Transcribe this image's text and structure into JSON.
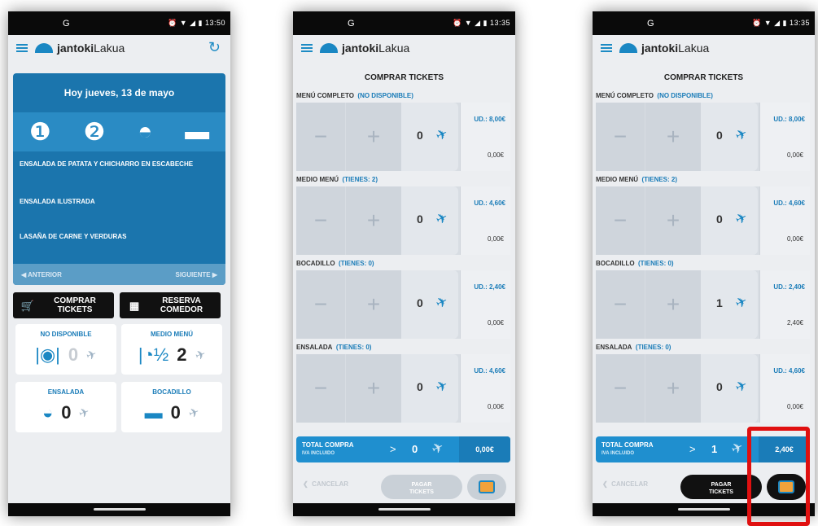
{
  "phone1": {
    "status": {
      "left": "G",
      "right": "⏰ ▼ ◢ ▮ 13:50"
    },
    "brand": {
      "bold": "jantoki",
      "light": "Lakua"
    },
    "date": "Hoy jueves, 13 de mayo",
    "dishes": [
      "ENSALADA DE PATATA Y CHICHARRO EN ESCABECHE",
      "ENSALADA ILUSTRADA",
      "LASAÑA DE CARNE Y VERDURAS"
    ],
    "prev": "◀  ANTERIOR",
    "next": "SIGUIENTE  ▶",
    "buy_btn": "COMPRAR\nTICKETS",
    "reserve_btn": "RESERVA\nCOMEDOR",
    "tiles": [
      {
        "label": "NO DISPONIBLE",
        "count": "0",
        "icon": "meal-icon"
      },
      {
        "label": "MEDIO MENÚ",
        "count": "2",
        "icon": "half-meal-icon"
      },
      {
        "label": "ENSALADA",
        "count": "0",
        "icon": "salad-icon"
      },
      {
        "label": "BOCADILLO",
        "count": "0",
        "icon": "sandwich-icon"
      }
    ]
  },
  "phone2": {
    "status": {
      "left": "G",
      "right": "⏰ ▼ ◢ ▮ 13:35"
    },
    "brand": {
      "bold": "jantoki",
      "light": "Lakua"
    },
    "title": "COMPRAR TICKETS",
    "sections": [
      {
        "name": "MENÚ COMPLETO",
        "state": "(NO DISPONIBLE)",
        "qty": "0",
        "ud": "UD.: 8,00€",
        "sub": "0,00€"
      },
      {
        "name": "MEDIO MENÚ",
        "state": "(TIENES: 2)",
        "qty": "0",
        "ud": "UD.: 4,60€",
        "sub": "0,00€"
      },
      {
        "name": "BOCADILLO",
        "state": "(TIENES: 0)",
        "qty": "0",
        "ud": "UD.: 2,40€",
        "sub": "0,00€"
      },
      {
        "name": "ENSALADA",
        "state": "(TIENES: 0)",
        "qty": "0",
        "ud": "UD.: 4,60€",
        "sub": "0,00€"
      }
    ],
    "total_label": "TOTAL COMPRA",
    "total_sub": "IVA INCLUIDO",
    "total_qty": "0",
    "total_amount": "0,00€",
    "cancel": "CANCELAR",
    "pay": "PAGAR\nTICKETS"
  },
  "phone3": {
    "status": {
      "left": "G",
      "right": "⏰ ▼ ◢ ▮ 13:35"
    },
    "brand": {
      "bold": "jantoki",
      "light": "Lakua"
    },
    "title": "COMPRAR TICKETS",
    "sections": [
      {
        "name": "MENÚ COMPLETO",
        "state": "(NO DISPONIBLE)",
        "qty": "0",
        "ud": "UD.: 8,00€",
        "sub": "0,00€"
      },
      {
        "name": "MEDIO MENÚ",
        "state": "(TIENES: 2)",
        "qty": "0",
        "ud": "UD.: 4,60€",
        "sub": "0,00€"
      },
      {
        "name": "BOCADILLO",
        "state": "(TIENES: 0)",
        "qty": "1",
        "ud": "UD.: 2,40€",
        "sub": "2,40€"
      },
      {
        "name": "ENSALADA",
        "state": "(TIENES: 0)",
        "qty": "0",
        "ud": "UD.: 4,60€",
        "sub": "0,00€"
      }
    ],
    "total_label": "TOTAL COMPRA",
    "total_sub": "IVA INCLUIDO",
    "total_qty": "1",
    "total_amount": "2,40€",
    "cancel": "CANCELAR",
    "pay": "PAGAR\nTICKETS"
  },
  "colors": {
    "accent": "#1a87c3",
    "highlight": "#e01010"
  }
}
